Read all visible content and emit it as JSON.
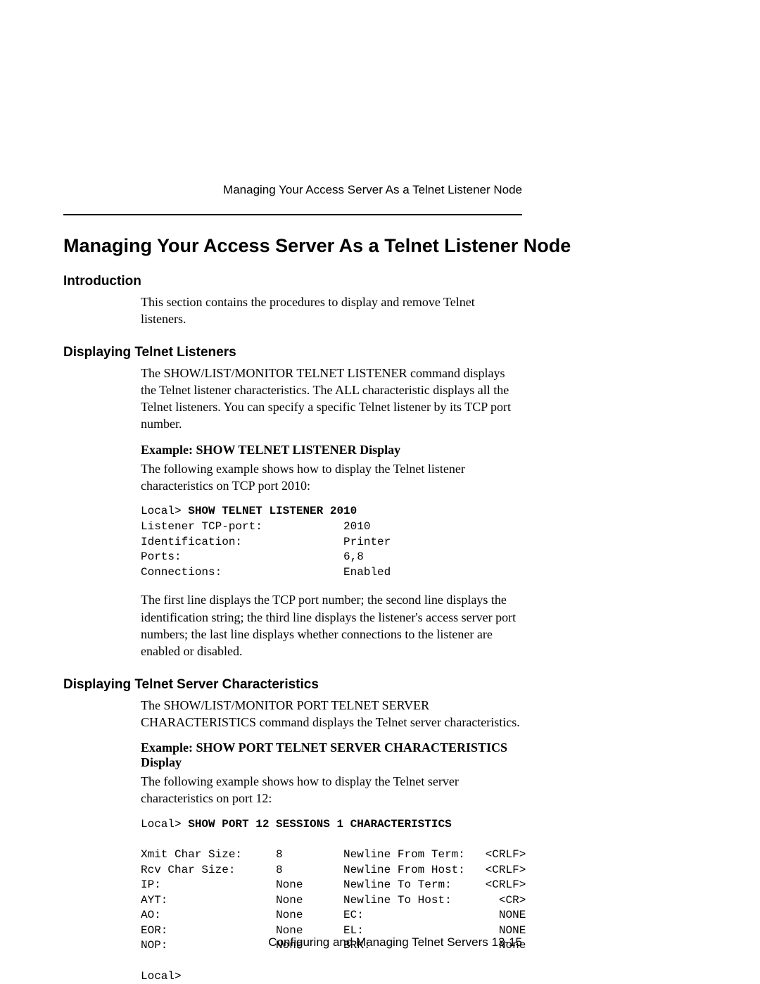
{
  "running_header": "Managing Your Access Server As a Telnet Listener Node",
  "title": "Managing Your Access Server As a Telnet Listener Node",
  "sections": {
    "intro": {
      "heading": "Introduction",
      "text": "This section contains the procedures to display and remove Telnet listeners."
    },
    "disp_listeners": {
      "heading": "Displaying Telnet Listeners",
      "para1": "The SHOW/LIST/MONITOR TELNET LISTENER command displays the Telnet listener characteristics. The ALL characteristic displays all the Telnet listeners. You can specify a specific Telnet listener by its TCP port number.",
      "example_heading": "Example: SHOW TELNET LISTENER Display",
      "para2": "The following example shows how to display the Telnet listener characteristics on TCP port 2010:",
      "code_prefix": "Local> ",
      "code_cmd": "SHOW TELNET LISTENER 2010",
      "code_body": "Listener TCP-port:            2010\nIdentification:               Printer\nPorts:                        6,8\nConnections:                  Enabled",
      "para3": "The first line displays the TCP port number; the second line displays the identification string; the third line displays the listener's access server port numbers; the last line displays whether connections to the listener are enabled or disabled."
    },
    "disp_server": {
      "heading": "Displaying Telnet Server Characteristics",
      "para1": "The SHOW/LIST/MONITOR PORT TELNET SERVER CHARACTERISTICS command displays the Telnet server characteristics.",
      "example_heading": "Example: SHOW PORT TELNET SERVER CHARACTERISTICS Display",
      "para2": "The following example shows how to display the Telnet server characteristics on port 12:",
      "code_prefix": "Local> ",
      "code_cmd": "SHOW PORT 12 SESSIONS 1 CHARACTERISTICS",
      "code_body": "\nXmit Char Size:     8         Newline From Term:   <CRLF>\nRcv Char Size:      8         Newline From Host:   <CRLF>\nIP:                 None      Newline To Term:     <CRLF>\nAYT:                None      Newline To Host:       <CR>\nAO:                 None      EC:                    NONE\nEOR:                None      EL:                    NONE\nNOP:                None      BRK:                   None\n\nLocal>"
    }
  },
  "footer": "Configuring and Managing Telnet Servers 13-15"
}
